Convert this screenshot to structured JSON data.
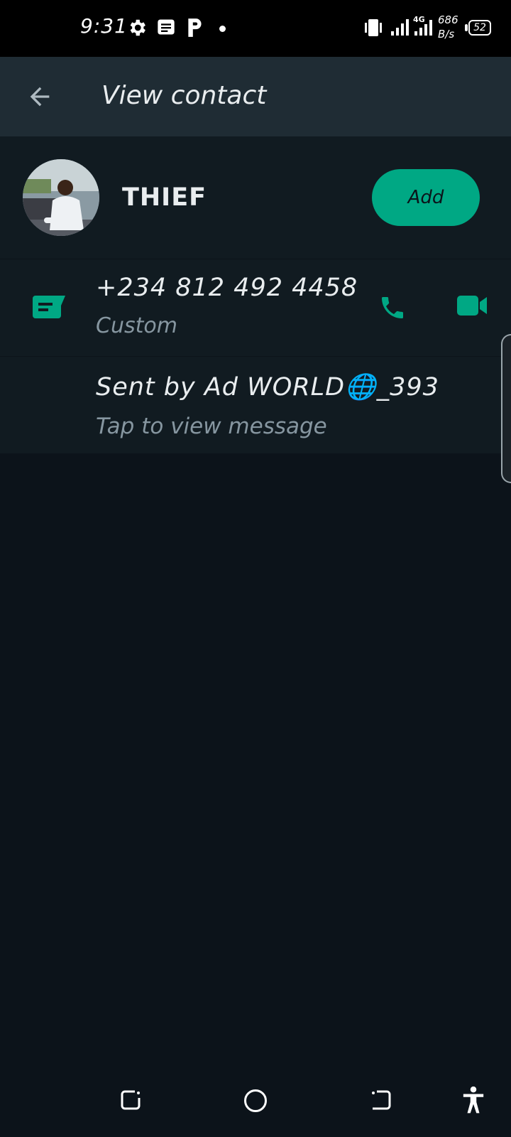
{
  "status_bar": {
    "time": "9:31",
    "net_speed_value": "686",
    "net_speed_unit": "B/s",
    "battery": "52",
    "icons": [
      "settings-icon",
      "message-icon",
      "p-app-icon",
      "vibrate-icon",
      "signal-icon",
      "4g-signal-icon",
      "battery-icon"
    ]
  },
  "app_bar": {
    "title": "View contact",
    "back_icon": "arrow-left-icon"
  },
  "contact": {
    "name": "THIEF",
    "add_label": "Add"
  },
  "phone": {
    "number": "+234 812 492 4458",
    "type": "Custom",
    "icons": [
      "message-icon",
      "phone-icon",
      "video-icon"
    ]
  },
  "source": {
    "title": "Sent by Ad WORLD🌐_393",
    "subtitle": "Tap to view message"
  },
  "nav_bar": {
    "icons": [
      "recents-icon",
      "home-icon",
      "back-icon",
      "accessibility-icon"
    ]
  },
  "colors": {
    "accent": "#00a884",
    "background": "#0c131a",
    "app_bar": "#1f2c34",
    "card": "#111b21",
    "secondary_text": "#8696a0"
  }
}
